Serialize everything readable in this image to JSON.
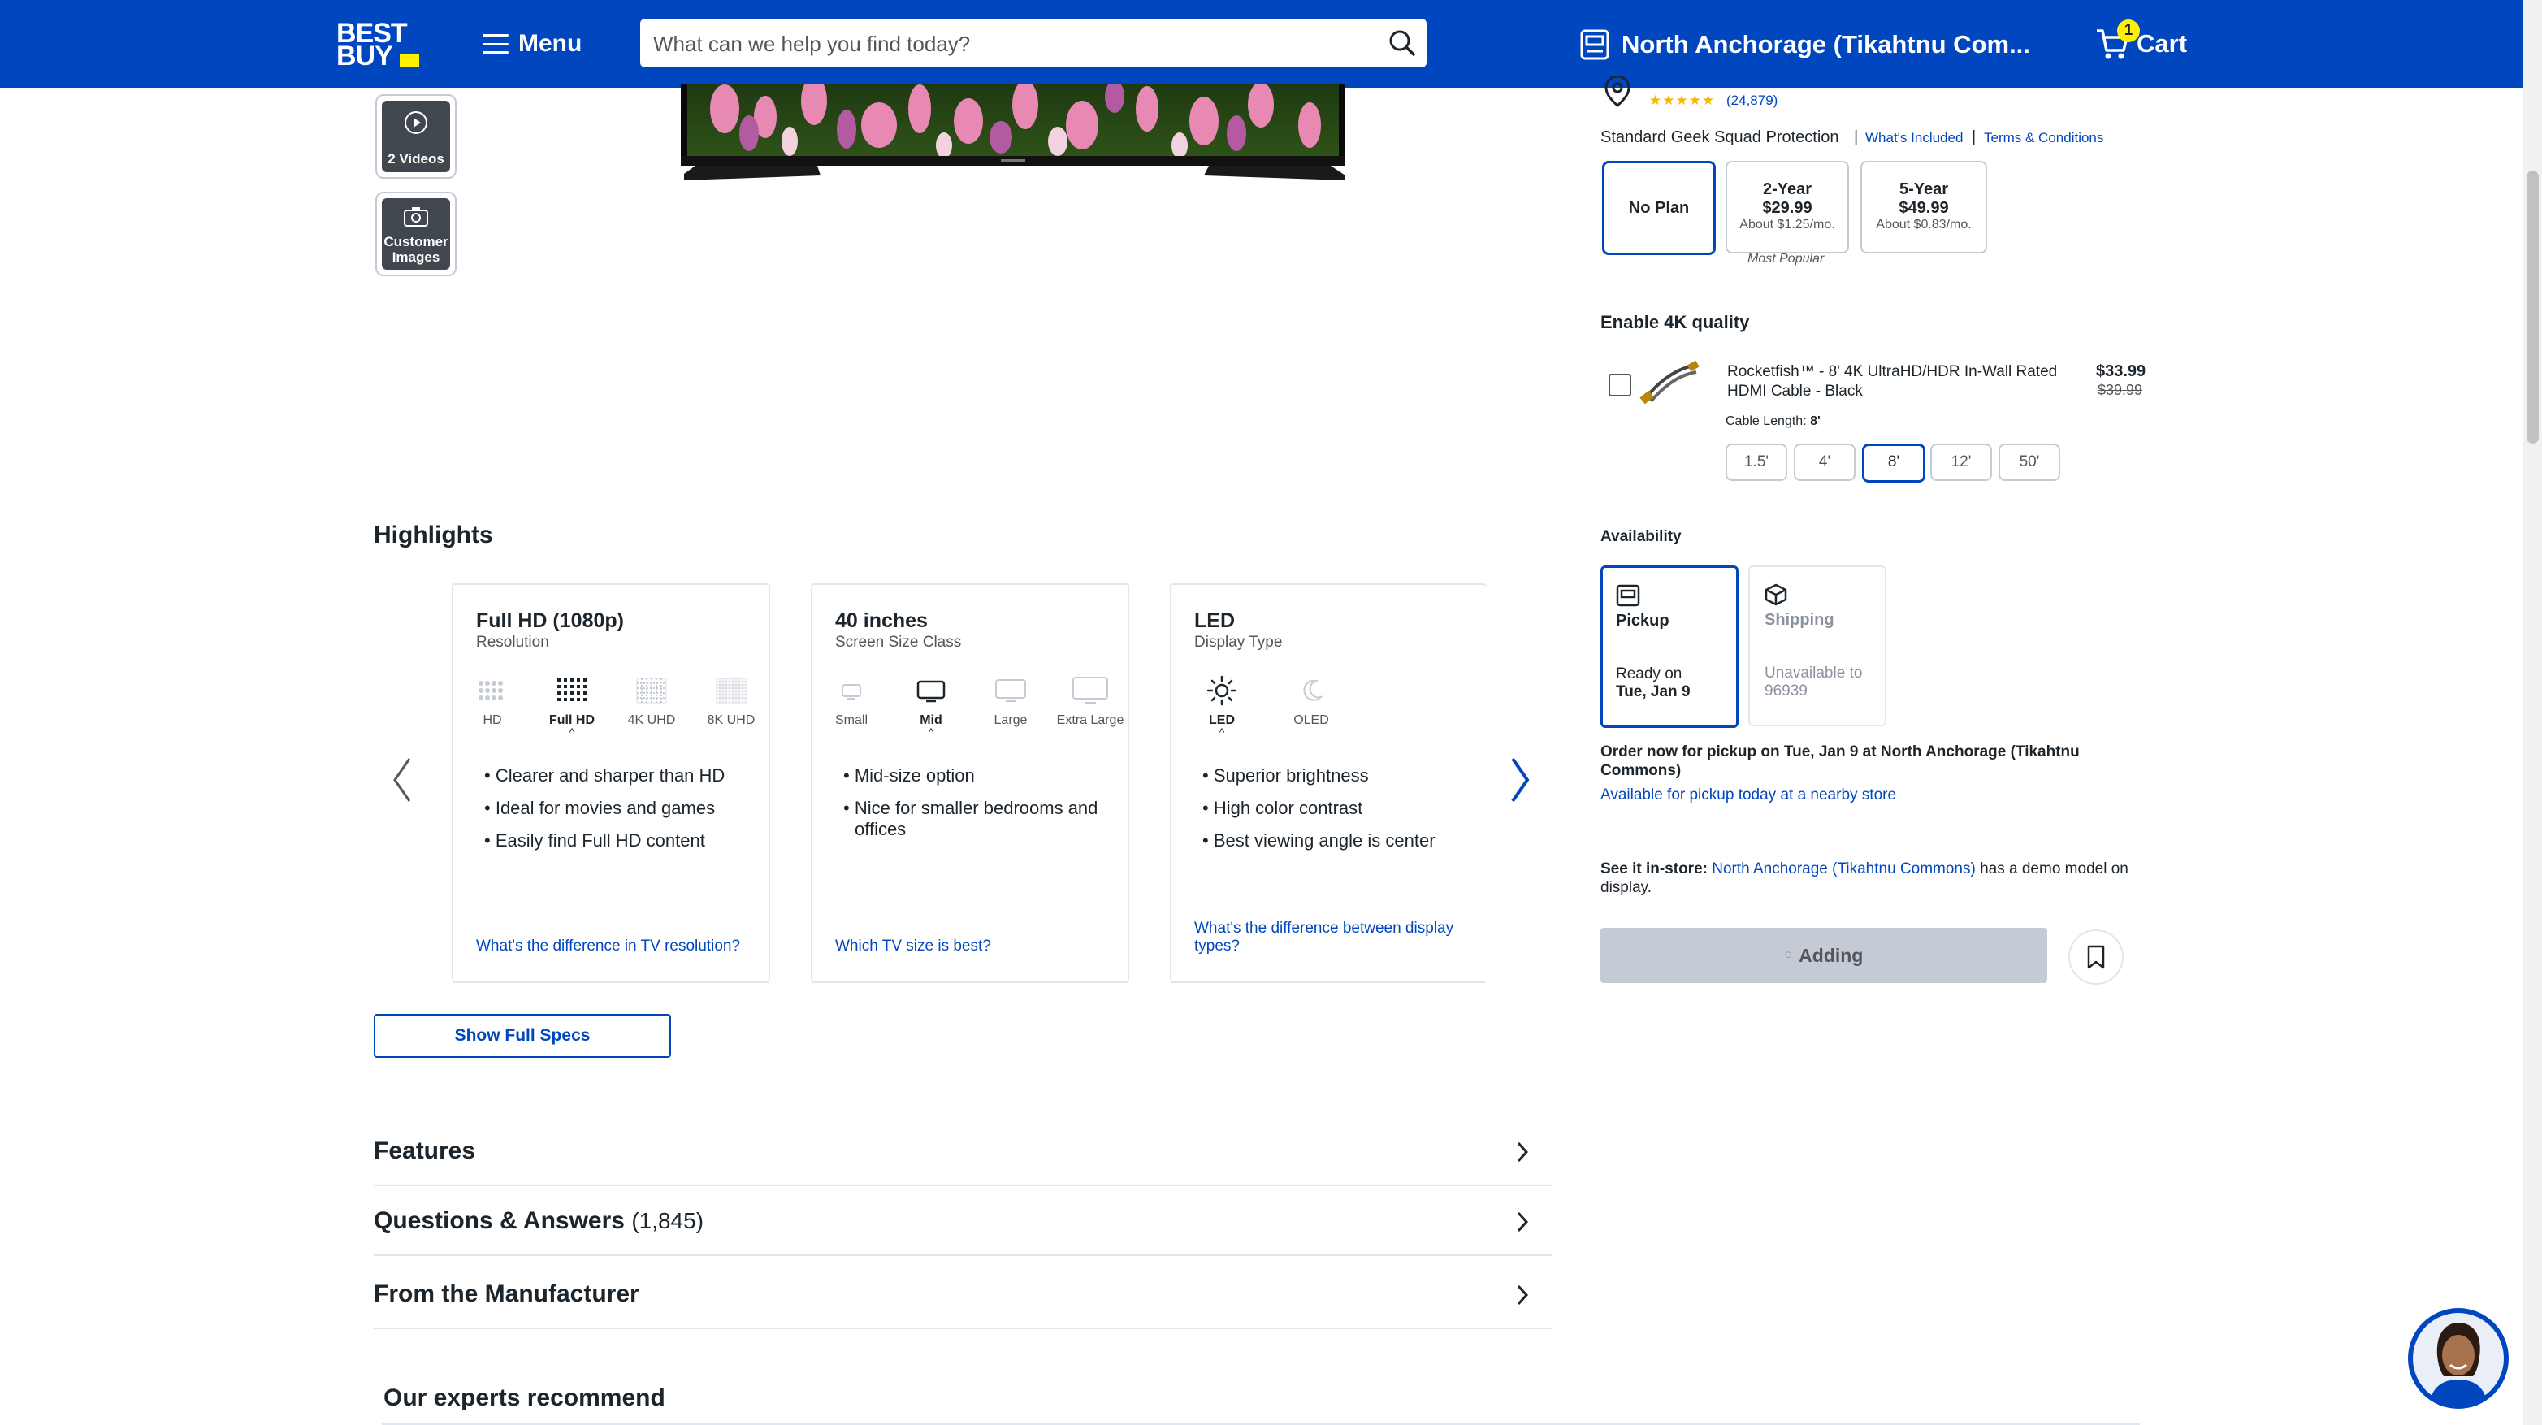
{
  "header": {
    "logo_line1": "BEST",
    "logo_line2": "BUY",
    "menu_label": "Menu",
    "search_placeholder": "What can we help you find today?",
    "store_label": "North Anchorage (Tikahtnu Com...",
    "cart_label": "Cart",
    "cart_count": "1"
  },
  "gallery": {
    "videos_label": "2 Videos",
    "customer_images_line1": "Customer",
    "customer_images_line2": "Images"
  },
  "rating": {
    "count": "(24,879)"
  },
  "protection": {
    "label": "Standard Geek Squad Protection",
    "whats_included": "What's Included",
    "terms": "Terms & Conditions",
    "plans": [
      {
        "label": "No Plan",
        "price": "",
        "monthly": ""
      },
      {
        "label": "2-Year",
        "price": "$29.99",
        "monthly": "About $1.25/mo."
      },
      {
        "label": "5-Year",
        "price": "$49.99",
        "monthly": "About $0.83/mo."
      }
    ],
    "most_popular": "Most Popular"
  },
  "addon": {
    "heading": "Enable 4K quality",
    "name": "Rocketfish™ - 8' 4K UltraHD/HDR In-Wall Rated HDMI Cable - Black",
    "price": "$33.99",
    "was_price": "$39.99",
    "length_label": "Cable Length:",
    "length_value": "8'",
    "lengths": [
      "1.5'",
      "4'",
      "8'",
      "12'",
      "50'"
    ]
  },
  "availability": {
    "heading": "Availability",
    "pickup_label": "Pickup",
    "pickup_line1": "Ready on",
    "pickup_line2": "Tue, Jan 9",
    "shipping_label": "Shipping",
    "shipping_line1": "Unavailable to",
    "shipping_line2": "96939",
    "order_now": "Order now for pickup on Tue, Jan 9 at North Anchorage (Tikahtnu Commons)",
    "nearby": "Available for pickup today at a nearby store",
    "see_instore_label": "See it in-store:",
    "see_instore_store": "North Anchorage (Tikahtnu Commons)",
    "see_instore_rest": " has a demo model on display.",
    "add_button": "Adding"
  },
  "highlights": {
    "heading": "Highlights",
    "cards": [
      {
        "title": "Full HD (1080p)",
        "subtitle": "Resolution",
        "options": [
          "HD",
          "Full HD",
          "4K UHD",
          "8K UHD"
        ],
        "selected": "Full HD",
        "bullets": [
          "Clearer and sharper than HD",
          "Ideal for movies and games",
          "Easily find Full HD content"
        ],
        "link": "What's the difference in TV resolution?"
      },
      {
        "title": "40 inches",
        "subtitle": "Screen Size Class",
        "options": [
          "Small",
          "Mid",
          "Large",
          "Extra Large"
        ],
        "selected": "Mid",
        "bullets": [
          "Mid-size option",
          "Nice for smaller bedrooms and offices"
        ],
        "link": "Which TV size is best?"
      },
      {
        "title": "LED",
        "subtitle": "Display Type",
        "options": [
          "LED",
          "OLED"
        ],
        "selected": "LED",
        "bullets": [
          "Superior brightness",
          "High color contrast",
          "Best viewing angle is center"
        ],
        "link": "What's the difference between display types?"
      }
    ],
    "show_specs": "Show Full Specs"
  },
  "sections": {
    "features": "Features",
    "qa": "Questions & Answers",
    "qa_count": "(1,845)",
    "manufacturer": "From the Manufacturer",
    "experts": "Our experts recommend"
  },
  "colors": {
    "brand_blue": "#0046be",
    "brand_yellow": "#fff200",
    "link_blue": "#0046be"
  }
}
